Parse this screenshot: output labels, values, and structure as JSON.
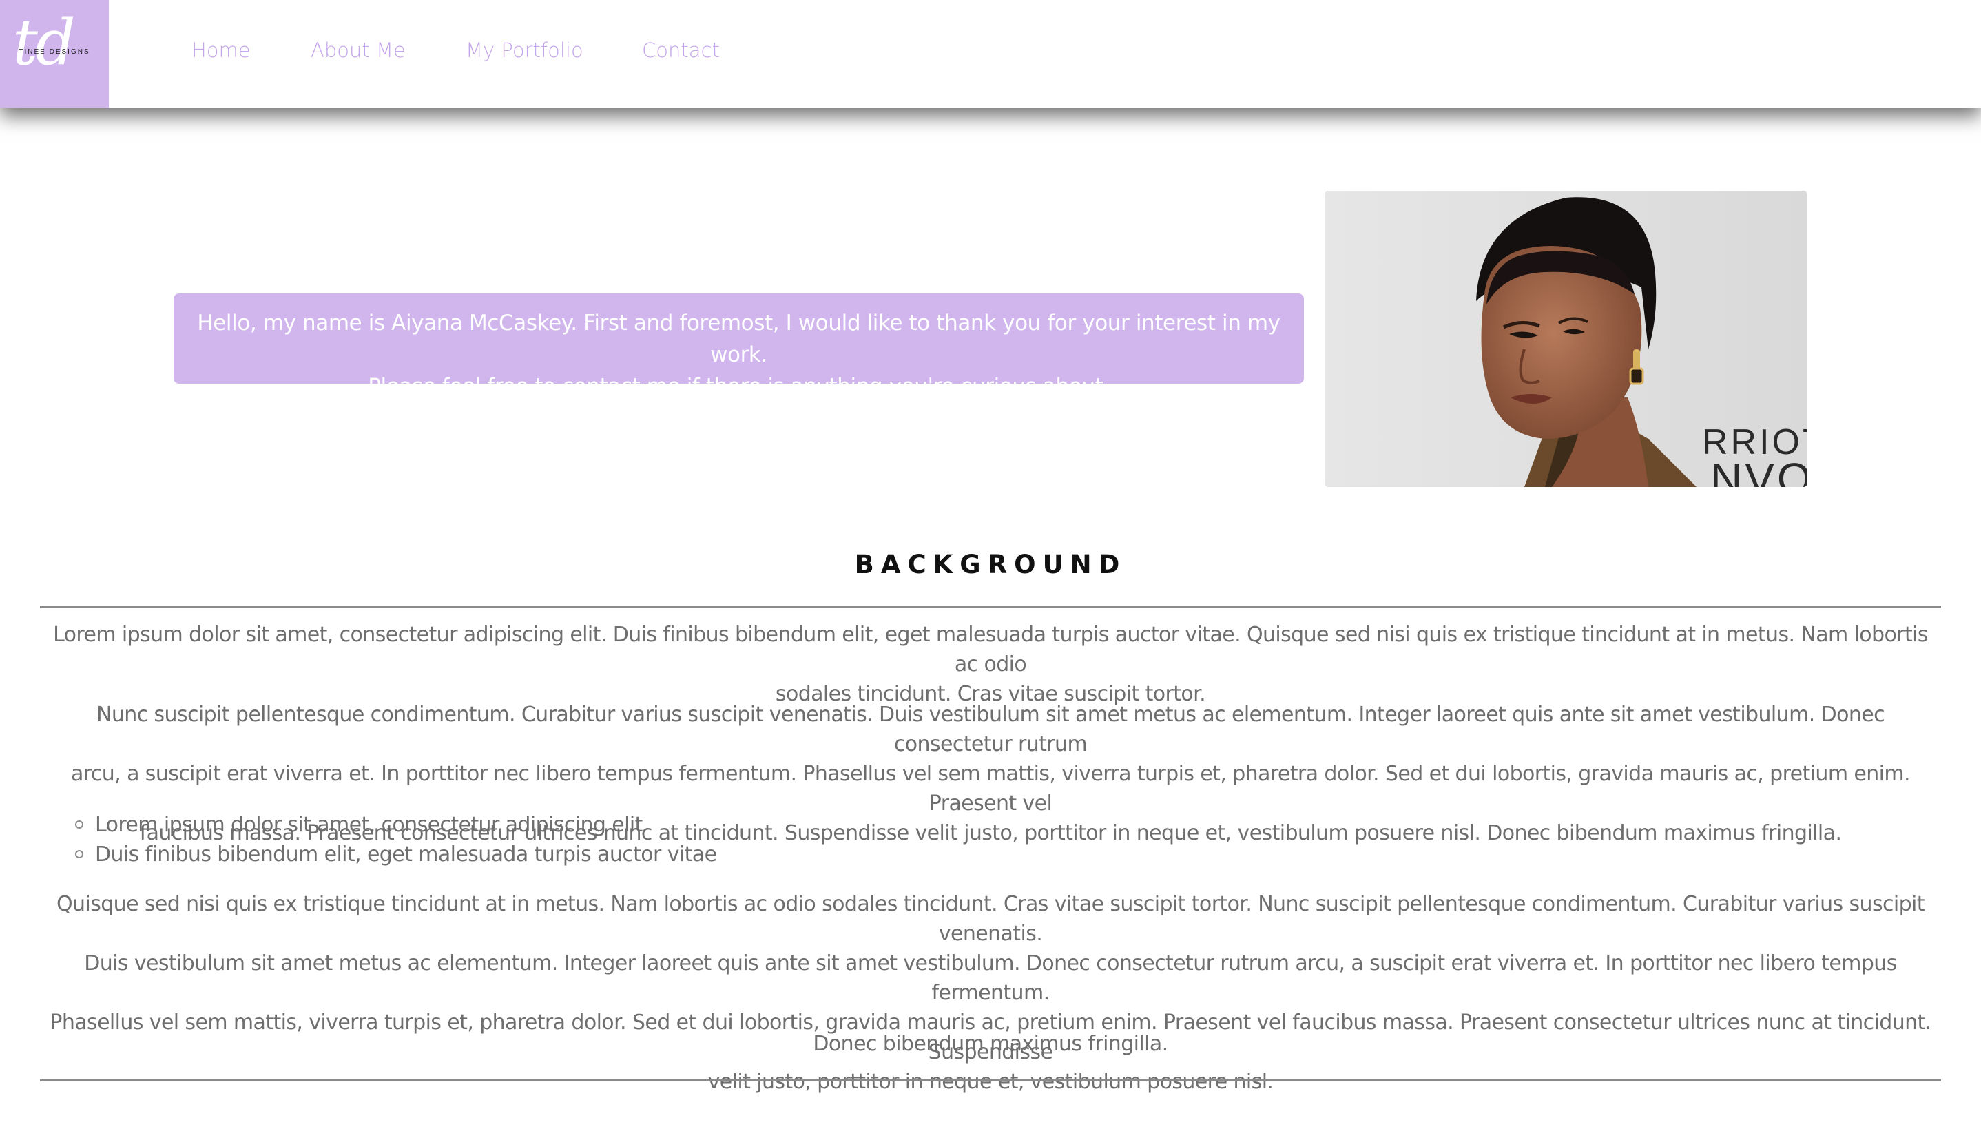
{
  "logo": {
    "monogram": "td",
    "brand_text": "TINEE DESIGNS"
  },
  "nav": {
    "items": [
      {
        "label": "Home"
      },
      {
        "label": "About Me"
      },
      {
        "label": "My Portfolio"
      },
      {
        "label": "Contact"
      }
    ]
  },
  "intro": {
    "line1": "Hello, my name is Aiyana McCaskey. First and foremost, I would like to thank you for your interest in my work.",
    "line2": "Please feel free to contact me if there is anything you're curious about."
  },
  "portrait": {
    "backdrop_text": "RRIOTT",
    "backdrop_text_2": "NVO"
  },
  "background": {
    "title": "BACKGROUND",
    "p1_l1": "Lorem ipsum dolor sit amet, consectetur adipiscing elit. Duis finibus bibendum elit, eget malesuada turpis auctor vitae. Quisque sed nisi quis ex tristique tincidunt at in metus. Nam lobortis ac odio",
    "p1_l2": "sodales tincidunt. Cras vitae suscipit tortor.",
    "p2_l1": "Nunc suscipit pellentesque condimentum. Curabitur varius suscipit venenatis. Duis vestibulum sit amet metus ac elementum. Integer laoreet quis ante sit amet vestibulum. Donec consectetur rutrum",
    "p2_l2": "arcu, a suscipit erat viverra et. In porttitor nec libero tempus fermentum. Phasellus vel sem mattis, viverra turpis et, pharetra dolor. Sed et dui lobortis, gravida mauris ac, pretium enim. Praesent vel",
    "p2_l3": "faucibus massa. Praesent consectetur ultrices nunc at tincidunt. Suspendisse velit justo, porttitor in neque et, vestibulum posuere nisl. Donec bibendum maximus fringilla.",
    "bullets": [
      "Lorem ipsum dolor sit amet, consectetur adipiscing elit",
      "Duis finibus bibendum elit, eget malesuada turpis auctor vitae"
    ],
    "p3_l1": "Quisque sed nisi quis ex tristique tincidunt at in metus. Nam lobortis ac odio sodales tincidunt. Cras vitae suscipit tortor. Nunc suscipit pellentesque condimentum. Curabitur varius suscipit venenatis.",
    "p3_l2": "Duis vestibulum sit amet metus ac elementum. Integer laoreet quis ante sit amet vestibulum. Donec consectetur rutrum arcu, a suscipit erat viverra et. In porttitor nec libero tempus fermentum.",
    "p3_l3": "Phasellus vel sem mattis, viverra turpis et, pharetra dolor. Sed et dui lobortis, gravida mauris ac, pretium enim. Praesent vel faucibus massa. Praesent consectetur ultrices nunc at tincidunt. Suspendisse",
    "p3_l4": "velit justo, porttitor in neque et, vestibulum posuere nisl.",
    "p4": "Donec bibendum maximus fringilla."
  },
  "colors": {
    "accent": "#cfb5ec",
    "nav_link": "#c4a6ea",
    "body_text": "#6e6e6e",
    "heading": "#111111"
  }
}
